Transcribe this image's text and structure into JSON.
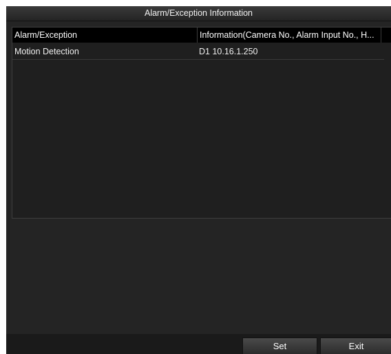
{
  "window": {
    "title": "Alarm/Exception Information"
  },
  "table": {
    "columns": [
      "Alarm/Exception",
      "Information(Camera No., Alarm Input No., H...",
      ""
    ],
    "rows": [
      {
        "alarm": "Motion Detection",
        "info": "D1  10.16.1.250"
      }
    ]
  },
  "footer": {
    "set_label": "Set",
    "exit_label": "Exit"
  }
}
